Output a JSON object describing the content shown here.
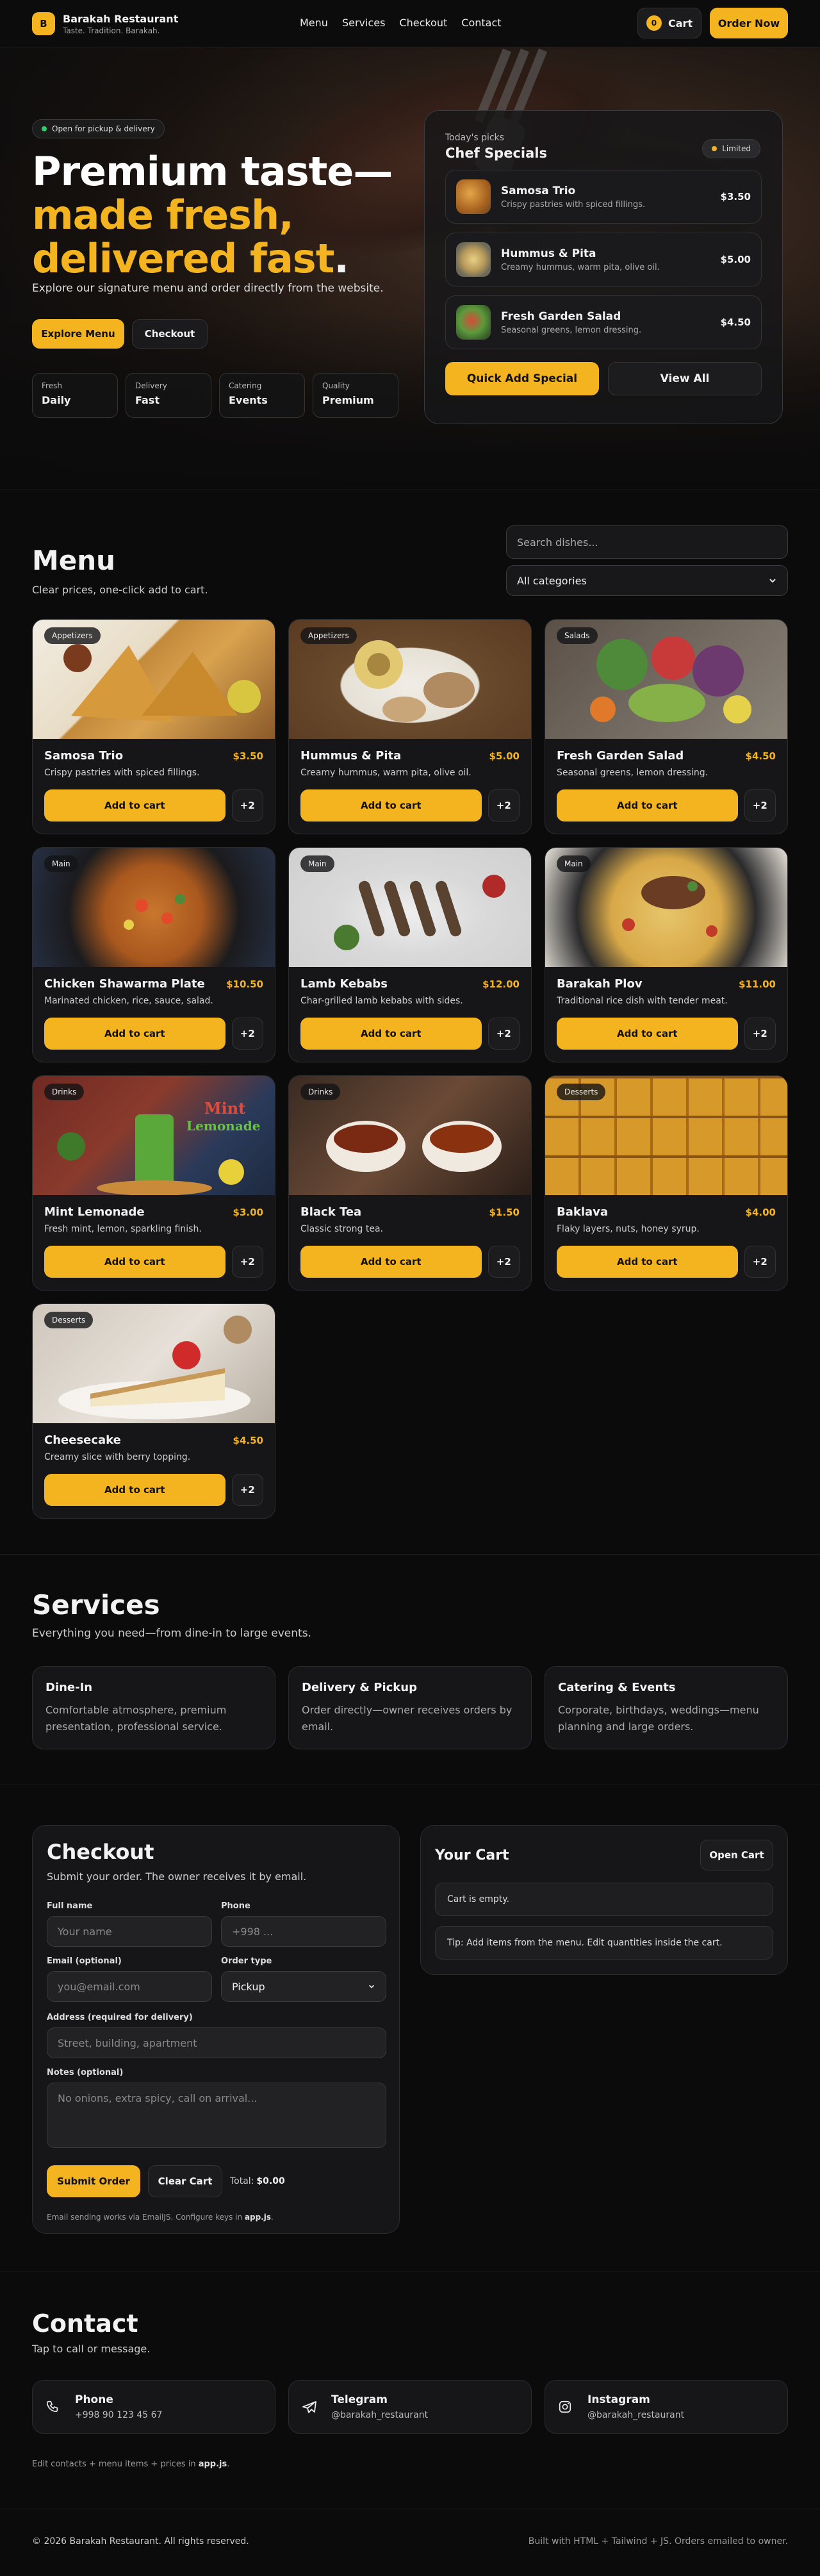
{
  "header": {
    "logo": "B",
    "brand": "Barakah Restaurant",
    "tagline": "Taste. Tradition. Barakah.",
    "nav": [
      "Menu",
      "Services",
      "Checkout",
      "Contact"
    ],
    "cart_count": "0",
    "cart_label": "Cart",
    "order_label": "Order Now"
  },
  "hero": {
    "status": "Open for pickup & delivery",
    "title_line1": "Premium taste—",
    "title_line2": "made fresh,",
    "title_line3": "delivered fast",
    "title_period": ".",
    "subtitle": "Explore our signature menu and order directly from the website.",
    "explore_label": "Explore Menu",
    "checkout_label": "Checkout",
    "stats": [
      {
        "label": "Fresh",
        "value": "Daily"
      },
      {
        "label": "Delivery",
        "value": "Fast"
      },
      {
        "label": "Catering",
        "value": "Events"
      },
      {
        "label": "Quality",
        "value": "Premium"
      }
    ]
  },
  "specials": {
    "kicker": "Today's picks",
    "title": "Chef Specials",
    "badge": "Limited",
    "items": [
      {
        "name": "Samosa Trio",
        "desc": "Crispy pastries with spiced fillings.",
        "price": "$3.50"
      },
      {
        "name": "Hummus & Pita",
        "desc": "Creamy hummus, warm pita, olive oil.",
        "price": "$5.00"
      },
      {
        "name": "Fresh Garden Salad",
        "desc": "Seasonal greens, lemon dressing.",
        "price": "$4.50"
      }
    ],
    "quick_label": "Quick Add Special",
    "view_label": "View All"
  },
  "menu": {
    "title": "Menu",
    "subtitle": "Clear prices, one-click add to cart.",
    "search_placeholder": "Search dishes...",
    "category": "All categories",
    "add_label": "Add to cart",
    "plus_label": "+2",
    "items": [
      {
        "tag": "Appetizers",
        "name": "Samosa Trio",
        "price": "$3.50",
        "desc": "Crispy pastries with spiced fillings."
      },
      {
        "tag": "Appetizers",
        "name": "Hummus & Pita",
        "price": "$5.00",
        "desc": "Creamy hummus, warm pita, olive oil."
      },
      {
        "tag": "Salads",
        "name": "Fresh Garden Salad",
        "price": "$4.50",
        "desc": "Seasonal greens, lemon dressing."
      },
      {
        "tag": "Main",
        "name": "Chicken Shawarma Plate",
        "price": "$10.50",
        "desc": "Marinated chicken, rice, sauce, salad."
      },
      {
        "tag": "Main",
        "name": "Lamb Kebabs",
        "price": "$12.00",
        "desc": "Char-grilled lamb kebabs with sides."
      },
      {
        "tag": "Main",
        "name": "Barakah Plov",
        "price": "$11.00",
        "desc": "Traditional rice dish with tender meat."
      },
      {
        "tag": "Drinks",
        "name": "Mint Lemonade",
        "price": "$3.00",
        "desc": "Fresh mint, lemon, sparkling finish."
      },
      {
        "tag": "Drinks",
        "name": "Black Tea",
        "price": "$1.50",
        "desc": "Classic strong tea."
      },
      {
        "tag": "Desserts",
        "name": "Baklava",
        "price": "$4.00",
        "desc": "Flaky layers, nuts, honey syrup."
      },
      {
        "tag": "Desserts",
        "name": "Cheesecake",
        "price": "$4.50",
        "desc": "Creamy slice with berry topping."
      }
    ],
    "img_text_mint": "Mint",
    "img_text_lemonade": "Lemonade"
  },
  "services": {
    "title": "Services",
    "subtitle": "Everything you need—from dine-in to large events.",
    "items": [
      {
        "title": "Dine-In",
        "desc": "Comfortable atmosphere, premium presentation, professional service."
      },
      {
        "title": "Delivery & Pickup",
        "desc": "Order directly—owner receives orders by email."
      },
      {
        "title": "Catering & Events",
        "desc": "Corporate, birthdays, weddings—menu planning and large orders."
      }
    ]
  },
  "checkout": {
    "title": "Checkout",
    "subtitle": "Submit your order. The owner receives it by email.",
    "name_label": "Full name",
    "name_ph": "Your name",
    "phone_label": "Phone",
    "phone_ph": "+998 ...",
    "email_label": "Email (optional)",
    "email_ph": "you@email.com",
    "type_label": "Order type",
    "type_value": "Pickup",
    "address_label": "Address (required for delivery)",
    "address_ph": "Street, building, apartment",
    "notes_label": "Notes (optional)",
    "notes_ph": "No onions, extra spicy, call on arrival...",
    "submit_label": "Submit Order",
    "clear_label": "Clear Cart",
    "total_label": "Total:",
    "total_value": "$0.00",
    "note_prefix": "Email sending works via EmailJS. Configure keys in ",
    "note_file": "app.js",
    "note_suffix": "."
  },
  "cart": {
    "title": "Your Cart",
    "open_label": "Open Cart",
    "empty": "Cart is empty.",
    "tip": "Tip: Add items from the menu. Edit quantities inside the cart."
  },
  "contact": {
    "title": "Contact",
    "subtitle": "Tap to call or message.",
    "items": [
      {
        "title": "Phone",
        "value": "+998 90 123 45 67",
        "icon": "phone-icon"
      },
      {
        "title": "Telegram",
        "value": "@barakah_restaurant",
        "icon": "telegram-icon"
      },
      {
        "title": "Instagram",
        "value": "@barakah_restaurant",
        "icon": "instagram-icon"
      }
    ],
    "note_prefix": "Edit contacts + menu items + prices in ",
    "note_file": "app.js",
    "note_suffix": "."
  },
  "footer": {
    "copyright": "© 2026 Barakah Restaurant. All rights reserved.",
    "built": "Built with HTML + Tailwind + JS. Orders emailed to owner."
  },
  "colors": {
    "accent": "#f4b41f",
    "background": "#0b0b0c",
    "card": "#161618",
    "status_green": "#2fcf6b"
  }
}
